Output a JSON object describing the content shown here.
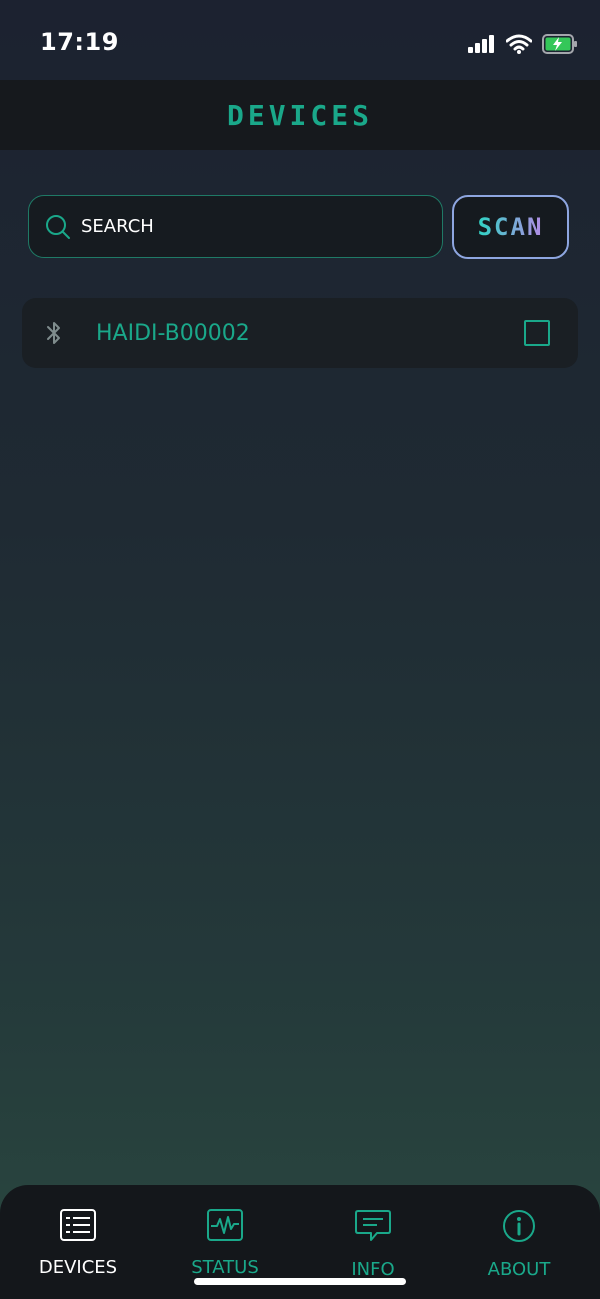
{
  "status_bar": {
    "time": "17:19"
  },
  "header": {
    "title": "DEVICES"
  },
  "search": {
    "placeholder": "SEARCH"
  },
  "scan": {
    "label": "SCAN"
  },
  "devices": [
    {
      "name": "HAIDI-B00002",
      "icon": "bluetooth-icon",
      "checked": false
    }
  ],
  "tabs": [
    {
      "label": "DEVICES",
      "icon": "list-icon",
      "active": true
    },
    {
      "label": "STATUS",
      "icon": "activity-icon",
      "active": false
    },
    {
      "label": "INFO",
      "icon": "message-icon",
      "active": false
    },
    {
      "label": "ABOUT",
      "icon": "info-icon",
      "active": false
    }
  ],
  "colors": {
    "accent": "#1aa88a",
    "header_bg": "#16191d",
    "tabbar_bg": "#14171b"
  }
}
